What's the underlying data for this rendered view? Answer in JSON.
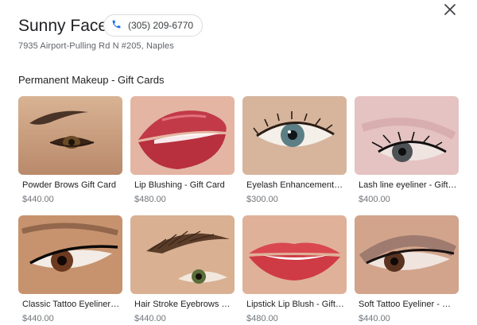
{
  "business": {
    "name": "Sunny Face",
    "phone": "(305) 209-6770",
    "address": "7935 Airport-Pulling Rd N #205, Naples"
  },
  "section": {
    "title": "Permanent Makeup - Gift Cards"
  },
  "products": [
    {
      "title": "Powder Brows Gift Card",
      "price": "$440.00",
      "image": "brows-closeup"
    },
    {
      "title": "Lip Blushing - Gift Card",
      "price": "$480.00",
      "image": "lips-closeup"
    },
    {
      "title": "Eyelash Enhancement Gift Card",
      "price": "$300.00",
      "image": "eye-closeup"
    },
    {
      "title": "Lash line eyeliner - Gift Card",
      "price": "$400.00",
      "image": "eye-lashline"
    },
    {
      "title": "Classic Tattoo Eyeliner Gift Card",
      "price": "$440.00",
      "image": "eye-eyeliner"
    },
    {
      "title": "Hair Stroke Eyebrows - Gift Card",
      "price": "$440.00",
      "image": "brow-hairstroke"
    },
    {
      "title": "Lipstick Lip Blush - Gift Card",
      "price": "$480.00",
      "image": "lips-lipstick"
    },
    {
      "title": "Soft Tattoo Eyeliner - Gift Card",
      "price": "$440.00",
      "image": "eye-smoky"
    }
  ],
  "icons": {
    "phone": "phone-icon",
    "close": "close-icon"
  },
  "colors": {
    "phone_icon": "#1a73e8",
    "text_primary": "#202124",
    "text_secondary": "#5f6368"
  }
}
